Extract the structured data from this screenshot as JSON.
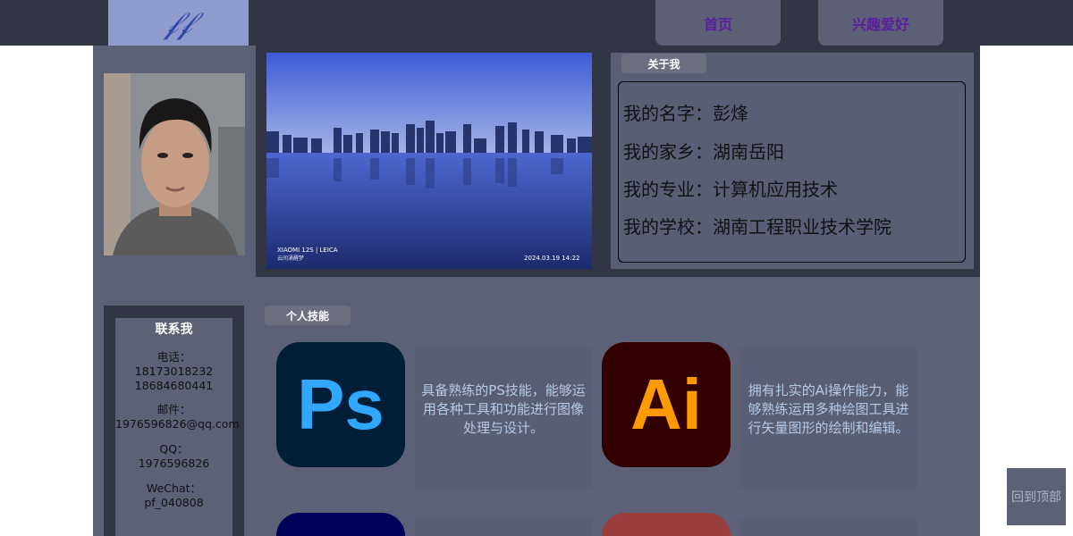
{
  "header": {
    "logo_text": "𝒻𝒻",
    "nav": [
      "首页",
      "兴趣爱好"
    ]
  },
  "about": {
    "tag": "关于我",
    "lines": [
      "我的名字：彭烽",
      "我的家乡：湖南岳阳",
      "我的专业：计算机应用技术",
      "我的学校：湖南工程职业技术学院"
    ]
  },
  "photo": {
    "watermark_brand": "XIAOMI 12S | LEICA",
    "watermark_sub": "云间涌醒梦",
    "watermark_time": "2024.03.19   14:22"
  },
  "contact": {
    "title": "联系我",
    "phone_label": "电话：",
    "phone1": "18173018232",
    "phone2": "18684680441",
    "email_label": "邮件：",
    "email": "1976596826@qq.com",
    "qq_label": "QQ：",
    "qq": "1976596826",
    "wechat_label": "WeChat：",
    "wechat": "pf_040808"
  },
  "skills": {
    "tag": "个人技能",
    "items": [
      {
        "icon": "Ps",
        "desc": "具备熟练的PS技能，能够运用各种工具和功能进行图像处理与设计。"
      },
      {
        "icon": "Ai",
        "desc": "拥有扎实的Ai操作能力，能够熟练运用多种绘图工具进行矢量图形的绘制和编辑。"
      }
    ]
  },
  "back_to_top": "回到顶部",
  "colors": {
    "header_bg": "#323543",
    "panel_bg": "#5d6177",
    "nav_text": "#5a1f9e",
    "ps_bg": "#001e36",
    "ps_fg": "#31a8ff",
    "ai_bg": "#330000",
    "ai_fg": "#ff9a00"
  }
}
